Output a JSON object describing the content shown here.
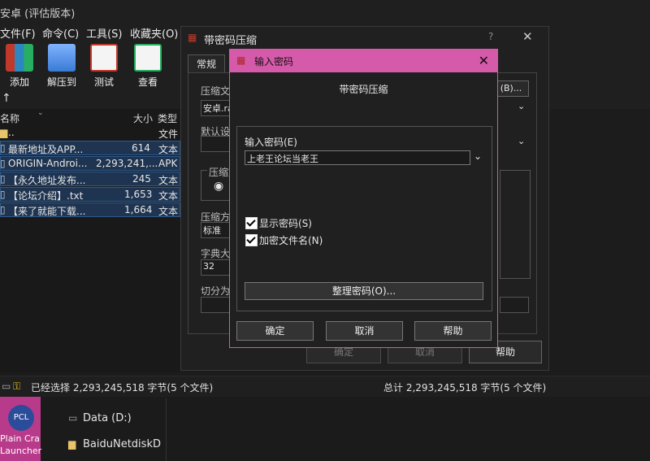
{
  "main": {
    "title": "安卓 (评估版本)",
    "menu": [
      "文件(F)",
      "命令(C)",
      "工具(S)",
      "收藏夹(O)"
    ],
    "toolbar": [
      "添加",
      "解压到",
      "测试",
      "查看"
    ],
    "columns": {
      "name": "名称",
      "size": "大小",
      "type": "类型"
    },
    "rows": [
      {
        "name": "..",
        "size": "",
        "type": "文件",
        "selected": false
      },
      {
        "name": "最新地址及APP...",
        "size": "614",
        "type": "文本",
        "selected": true
      },
      {
        "name": "ORIGIN-Androi...",
        "size": "2,293,241,...",
        "type": "APK",
        "selected": true
      },
      {
        "name": "【永久地址发布...",
        "size": "245",
        "type": "文本",
        "selected": true
      },
      {
        "name": "【论坛介绍】.txt",
        "size": "1,653",
        "type": "文本",
        "selected": true
      },
      {
        "name": "【来了就能下载...",
        "size": "1,664",
        "type": "文本",
        "selected": true
      }
    ],
    "status_left": "已经选择 2,293,245,518 字节(5 个文件)",
    "status_right": "总计 2,293,245,518 字节(5 个文件)"
  },
  "bg_dialog": {
    "title": "带密码压缩",
    "help_glyph": "?",
    "tab_general": "常规",
    "label_archive": "压缩文",
    "archive_value": "安卓.ra",
    "browse_label": "(B)...",
    "label_default": "默认设",
    "label_format": "压缩文",
    "label_method": "压缩方",
    "method_value": "标准",
    "label_dict": "字典大",
    "dict_value": "32",
    "label_split": "切分为",
    "ok": "确定",
    "cancel": "取消",
    "help": "帮助"
  },
  "pw_dialog": {
    "title": "输入密码",
    "subtitle": "带密码压缩",
    "label_password": "输入密码(E)",
    "password_value": "上老王论坛当老王",
    "show_password": "显示密码(S)",
    "encrypt_names": "加密文件名(N)",
    "organize": "整理密码(O)...",
    "ok": "确定",
    "cancel": "取消",
    "help": "帮助"
  },
  "desktop": {
    "pcl_label": "PCL",
    "pcl_name1": "Plain Cra",
    "pcl_name2": "Launcher",
    "drive": "Data (D:)",
    "folder": "BaiduNetdiskD"
  },
  "colors": {
    "accent": "#d65aaa",
    "selection": "#1e3450"
  }
}
